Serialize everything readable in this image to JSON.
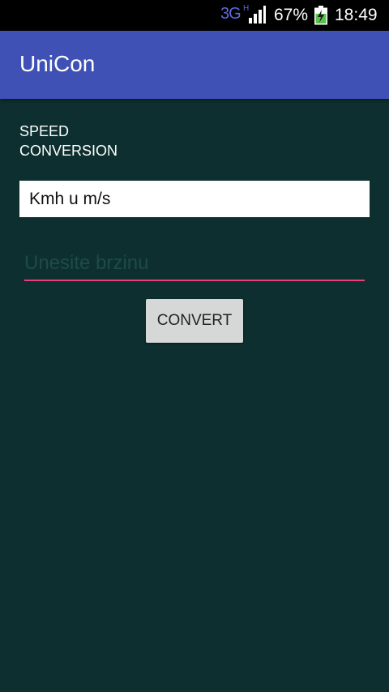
{
  "status_bar": {
    "network": "3G",
    "network_sub": "H",
    "battery_percent": "67%",
    "time": "18:49",
    "signal_icon": "signal-bars-icon",
    "battery_icon": "battery-charging-icon"
  },
  "app_bar": {
    "title": "UniCon",
    "color": "#3f51b5"
  },
  "main": {
    "section_label": "SPEED\nCONVERSION",
    "conversion_select": {
      "selected": "Kmh u m/s"
    },
    "speed_input": {
      "value": "",
      "placeholder": "Unesite brzinu",
      "underline_color": "#e8417a"
    },
    "convert_button": {
      "label": "CONVERT"
    },
    "background_color": "#0d2f2f"
  }
}
